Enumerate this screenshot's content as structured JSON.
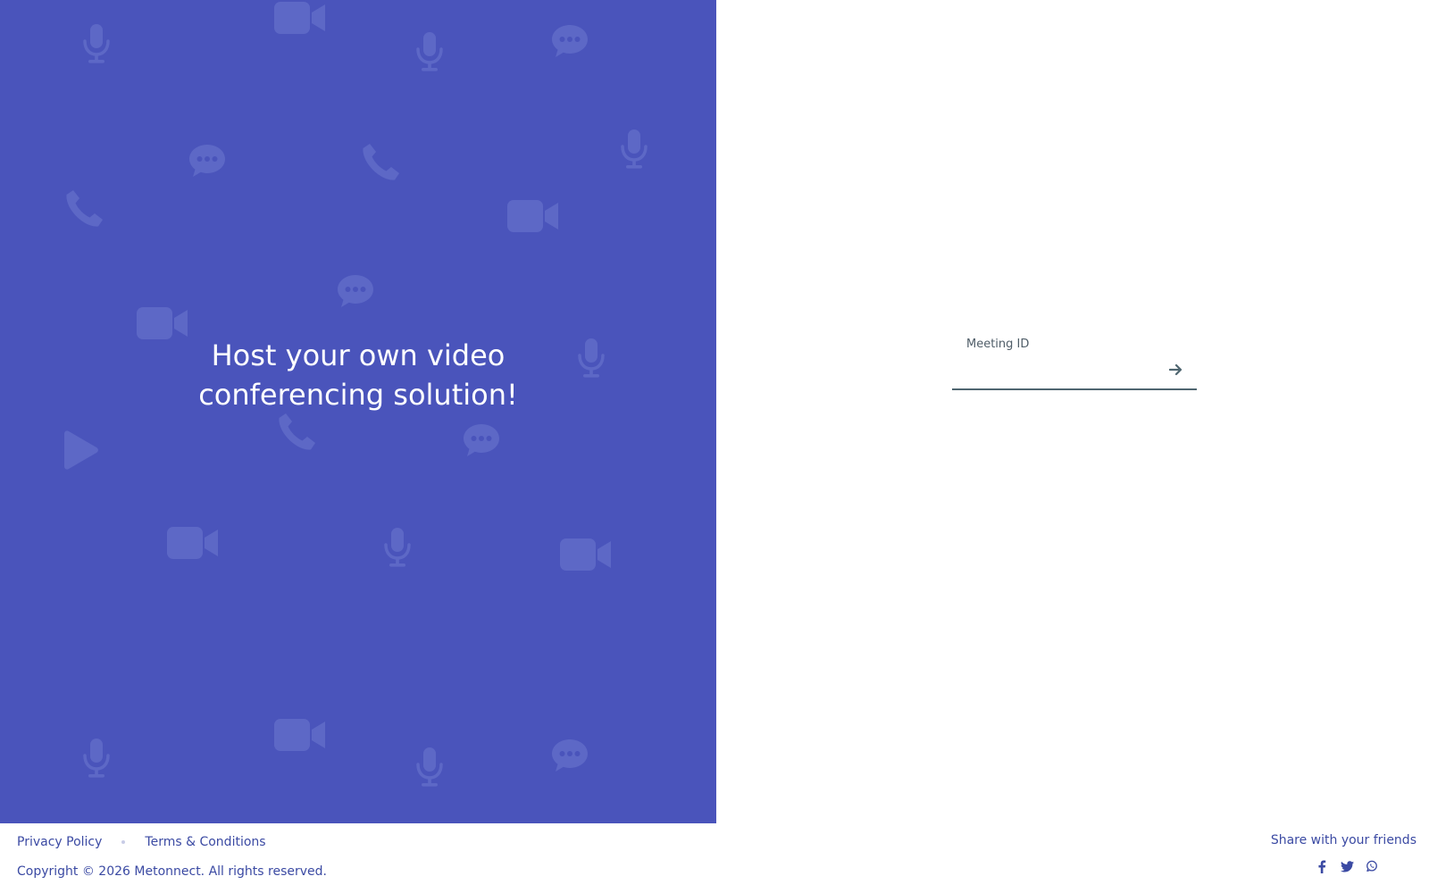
{
  "hero": {
    "title_line1": "Host your own video",
    "title_line2": "conferencing solution!",
    "background_color": "#4a54bb",
    "icon_color": "#5d68c6"
  },
  "join": {
    "label": "Meeting ID",
    "value": "",
    "placeholder": "",
    "submit_icon": "arrow-right-icon"
  },
  "footer": {
    "privacy_label": "Privacy Policy",
    "terms_label": "Terms & Conditions",
    "copyright": "Copyright © 2026 Metonnect. All rights reserved.",
    "share_label": "Share with your friends",
    "share_icons": [
      "facebook-icon",
      "twitter-icon",
      "whatsapp-icon"
    ],
    "text_color": "#3b4aa3"
  }
}
